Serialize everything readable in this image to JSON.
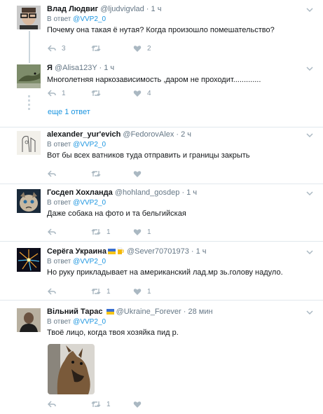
{
  "tweets": [
    {
      "name": "Влад Людвиг",
      "handle": "@ljudvigvlad",
      "time": " · 1 ч",
      "reply_prefix": "В ответ ",
      "reply_to": "@VVP2_0",
      "text": "Почему она такая ё  нутая? Когда произошло помешательство?",
      "replies": "3",
      "retweets": "",
      "likes": "2",
      "avatar": "man-with-glasses"
    },
    {
      "name": "Я",
      "handle": "@Alisa123Y",
      "time": " · 1 ч",
      "text": "Многолетняя наркозависимость ,даром не проходит.............",
      "replies": "1",
      "retweets": "",
      "likes": "4",
      "avatar": "lizard"
    },
    {
      "name": "alexander_yur'evich",
      "handle": "@FedorovAlex",
      "time": " · 2 ч",
      "reply_prefix": "В ответ ",
      "reply_to": "@VVP2_0",
      "text": "Вот бы всех ватников туда отправить и границы закрыть",
      "replies": "",
      "retweets": "",
      "likes": "",
      "avatar": "sketch"
    },
    {
      "name": "Госдеп Хохланда",
      "handle": "@hohland_gosdep",
      "time": " · 1 ч",
      "reply_prefix": "В ответ ",
      "reply_to": "@VVP2_0",
      "text": "Даже собака на фото и та бельгийская",
      "replies": "",
      "retweets": "1",
      "likes": "1",
      "avatar": "grumpy-cat"
    },
    {
      "name": "Серёга Украина",
      "handle": "@Sever70701973",
      "time": " · 1 ч",
      "reply_prefix": "В ответ ",
      "reply_to": "@VVP2_0",
      "text": "Но руку прикладывает  на американский лад.мр  зь.голову надуло.",
      "replies": "",
      "retweets": "1",
      "likes": "1",
      "avatar": "fireworks"
    },
    {
      "name": "Вільний Тарас",
      "handle": "@Ukraine_Forever",
      "time": " · 28 мин",
      "reply_prefix": "В ответ ",
      "reply_to": "@VVP2_0",
      "text": "Твоё лицо, когда твоя хозяйка пид  р.",
      "replies": "",
      "retweets": "1",
      "likes": "",
      "avatar": "person-dark"
    }
  ],
  "thread": {
    "more_replies": "еще 1 ответ"
  },
  "colors": {
    "link": "#1b95e0",
    "muted": "#657786",
    "icon": "#aab8c2",
    "flag_blue": "#3a6fd0",
    "flag_yellow": "#f5c518"
  }
}
